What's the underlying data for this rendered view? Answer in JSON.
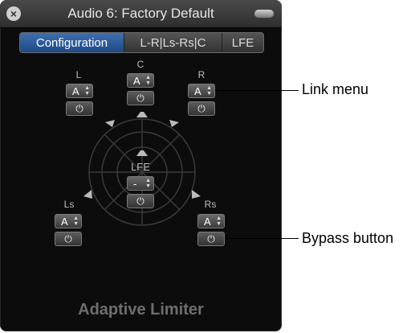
{
  "window": {
    "title": "Audio 6: Factory Default",
    "footer": "Adaptive Limiter"
  },
  "tabs": [
    {
      "label": "Configuration",
      "active": true
    },
    {
      "label": "L-R|Ls-Rs|C"
    },
    {
      "label": "LFE"
    }
  ],
  "channels": {
    "L": {
      "label": "L",
      "link": "A"
    },
    "C": {
      "label": "C",
      "link": "A"
    },
    "R": {
      "label": "R",
      "link": "A"
    },
    "LFE": {
      "label": "LFE",
      "link": "-"
    },
    "Ls": {
      "label": "Ls",
      "link": "A"
    },
    "Rs": {
      "label": "Rs",
      "link": "A"
    }
  },
  "icons": {
    "close": "×",
    "power": "⏻",
    "stepper": "▲▼"
  },
  "callouts": {
    "link_menu": "Link menu",
    "bypass_button": "Bypass button"
  },
  "colors": {
    "accent": "#2a5a9a",
    "panel": "#0c0c0c"
  }
}
